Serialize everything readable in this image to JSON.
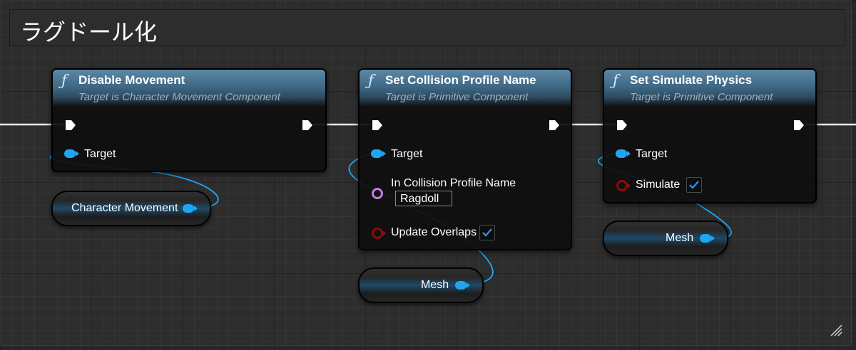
{
  "comment": {
    "title": "ラグドール化"
  },
  "nodes": {
    "disable_movement": {
      "icon": "function-icon",
      "title": "Disable Movement",
      "subtitle": "Target is Character Movement Component",
      "pins": {
        "target": "Target"
      }
    },
    "set_collision_profile": {
      "icon": "function-icon",
      "title": "Set Collision Profile Name",
      "subtitle": "Target is Primitive Component",
      "pins": {
        "target": "Target",
        "profile_name_label": "In Collision Profile Name",
        "profile_name_value": "Ragdoll",
        "update_overlaps_label": "Update Overlaps",
        "update_overlaps_checked": true
      }
    },
    "set_simulate_physics": {
      "icon": "function-icon",
      "title": "Set Simulate Physics",
      "subtitle": "Target is Primitive Component",
      "pins": {
        "target": "Target",
        "simulate_label": "Simulate",
        "simulate_checked": true
      }
    }
  },
  "variables": {
    "character_movement": "Character Movement",
    "mesh_1": "Mesh",
    "mesh_2": "Mesh"
  },
  "colors": {
    "object_pin": "#1ea6f3",
    "bool_pin": "#8d0c0c",
    "name_pin": "#c27ae3",
    "exec_pin": "#ffffff",
    "header_blue": "#3f6986"
  }
}
